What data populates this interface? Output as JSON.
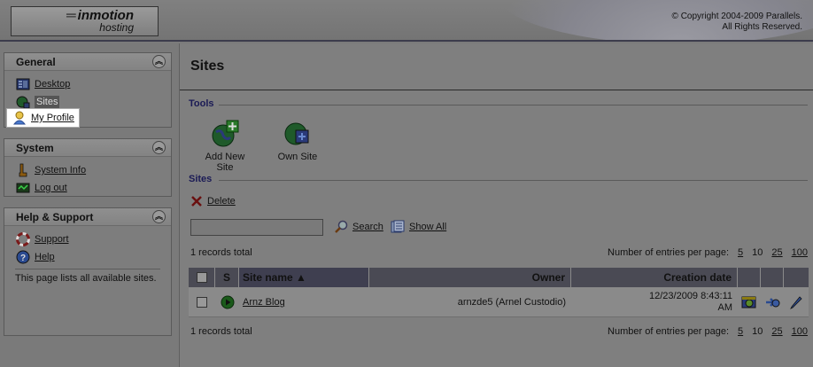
{
  "header": {
    "logo_line1": "inmotion",
    "logo_line2": "hosting",
    "copyright_line1": "© Copyright 2004-2009 Parallels.",
    "copyright_line2": "All Rights Reserved."
  },
  "sidebar": {
    "general": {
      "title": "General",
      "items": [
        {
          "label": "Desktop",
          "icon": "desktop-icon"
        },
        {
          "label": "Sites",
          "icon": "sites-icon"
        },
        {
          "label": "My Profile",
          "icon": "profile-icon"
        }
      ]
    },
    "system": {
      "title": "System",
      "items": [
        {
          "label": "System Info",
          "icon": "info-icon"
        },
        {
          "label": "Log out",
          "icon": "logout-icon"
        }
      ]
    },
    "help": {
      "title": "Help & Support",
      "items": [
        {
          "label": "Support",
          "icon": "lifebuoy-icon"
        },
        {
          "label": "Help",
          "icon": "question-icon"
        }
      ],
      "text": "This page lists all available sites."
    }
  },
  "main": {
    "title": "Sites",
    "tools_label": "Tools",
    "tools": [
      {
        "label": "Add New Site"
      },
      {
        "label": "Own Site"
      }
    ],
    "sites_label": "Sites",
    "delete_label": "Delete",
    "search_value": "",
    "search_label": "Search",
    "show_all_label": "Show All",
    "records_total": "1 records total",
    "per_page_label": "Number of entries per page:",
    "per_page_options": [
      "5",
      "10",
      "25",
      "100"
    ],
    "columns": {
      "s": "S",
      "site_name": "Site name ▲",
      "owner": "Owner",
      "creation_date": "Creation date"
    },
    "rows": [
      {
        "site_name": "Arnz Blog",
        "owner": "arnzde5 (Arnel Custodio)",
        "creation_date": "12/23/2009 8:43:11 AM"
      }
    ]
  }
}
